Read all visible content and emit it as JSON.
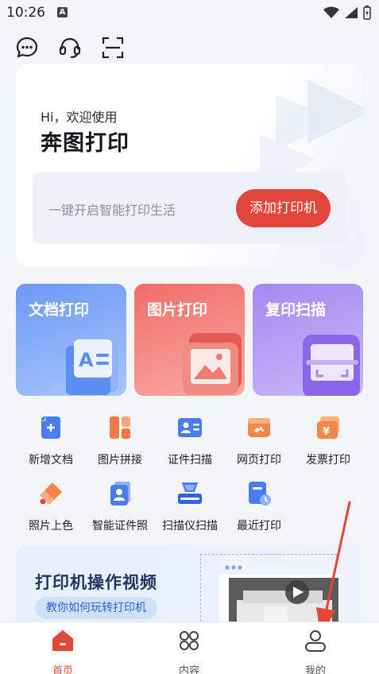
{
  "status_bar": {
    "time": "10:26",
    "notif_icon": "A"
  },
  "top_icons": [
    "message-icon",
    "headset-icon",
    "scan-icon"
  ],
  "welcome": {
    "greeting": "Hi，欢迎使用",
    "app_name": "奔图打印",
    "add_prompt": "一键开启智能打印生活",
    "add_button": "添加打印机"
  },
  "big_cards": [
    {
      "label": "文档打印",
      "icon": "document-icon",
      "color": "#6d99f5"
    },
    {
      "label": "图片打印",
      "icon": "image-icon",
      "color": "#f26d68"
    },
    {
      "label": "复印扫描",
      "icon": "scan-icon",
      "color": "#a58af0"
    }
  ],
  "grid": [
    {
      "label": "新增文档",
      "icon": "new-document-icon"
    },
    {
      "label": "图片拼接",
      "icon": "image-collage-icon"
    },
    {
      "label": "证件扫描",
      "icon": "id-card-icon"
    },
    {
      "label": "网页打印",
      "icon": "web-link-icon"
    },
    {
      "label": "发票打印",
      "icon": "invoice-icon"
    },
    {
      "label": "照片上色",
      "icon": "paint-bucket-icon"
    },
    {
      "label": "智能证件照",
      "icon": "id-photo-icon"
    },
    {
      "label": "扫描仪扫描",
      "icon": "scanner-icon"
    },
    {
      "label": "最近打印",
      "icon": "recent-document-icon"
    }
  ],
  "video": {
    "title": "打印机操作视频",
    "subtitle": "教你如何玩转打印机"
  },
  "nav": [
    {
      "label": "首页",
      "icon": "home-icon",
      "active": true
    },
    {
      "label": "内容",
      "icon": "content-grid-icon",
      "active": false
    },
    {
      "label": "我的",
      "icon": "profile-icon",
      "active": false
    }
  ],
  "colors": {
    "accent": "#e4463c",
    "blue": "#4a7cf0"
  }
}
